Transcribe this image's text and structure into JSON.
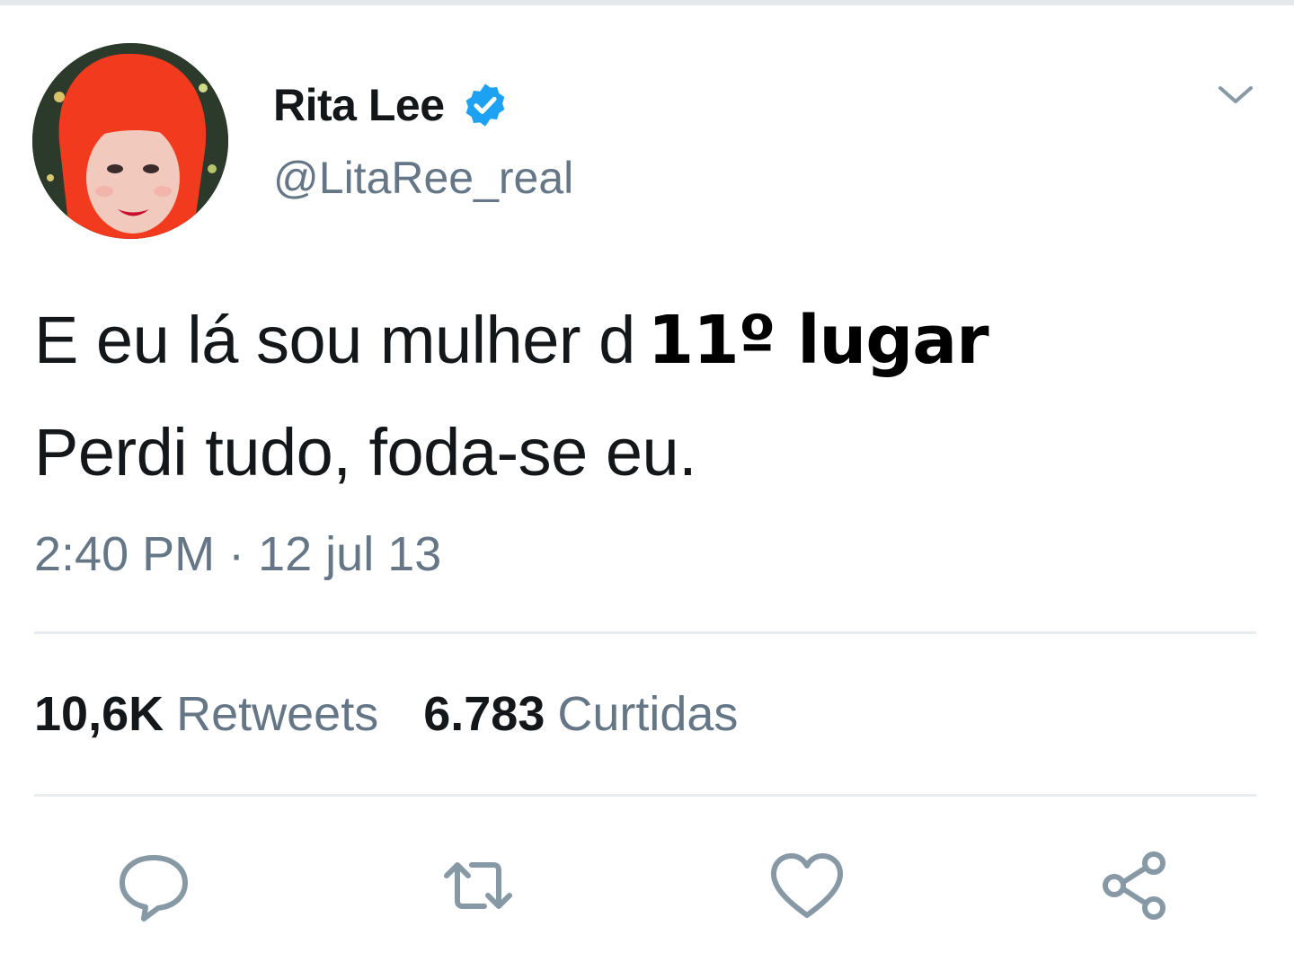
{
  "tweet": {
    "display_name": "Rita Lee",
    "handle": "@LitaRee_real",
    "line1_text": "E eu lá sou mulher d",
    "line1_overlay": "11º lugar",
    "line2_text": "Perdi tudo, foda-se eu.",
    "timestamp": "2:40 PM · 12 jul 13"
  },
  "stats": {
    "retweets_count": "10,6K",
    "retweets_label": "Retweets",
    "likes_count": "6.783",
    "likes_label": "Curtidas"
  },
  "icons": {
    "verified": "verified-badge-icon",
    "menu": "chevron-down-icon",
    "reply": "reply-bubble-icon",
    "retweet": "retweet-arrows-icon",
    "like": "heart-icon",
    "share": "share-icon"
  },
  "colors": {
    "verified_blue": "#1da1f2",
    "text": "#14171a",
    "secondary": "#657786",
    "avatar_hair": "#f23a1e"
  }
}
